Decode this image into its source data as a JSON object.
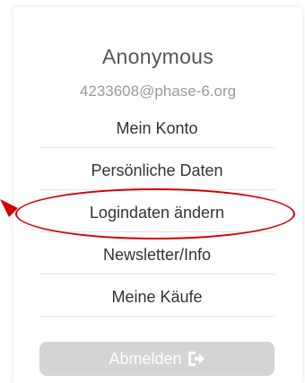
{
  "user": {
    "name": "Anonymous",
    "email": "4233608@phase-6.org"
  },
  "menu": {
    "items": [
      {
        "label": "Mein Konto"
      },
      {
        "label": "Persönliche Daten"
      },
      {
        "label": "Logindaten ändern"
      },
      {
        "label": "Newsletter/Info"
      },
      {
        "label": "Meine Käufe"
      }
    ]
  },
  "logout": {
    "label": "Abmelden",
    "icon": "logout-icon"
  },
  "colors": {
    "highlight": "#d40000",
    "button_disabled": "#d4d4d4",
    "text_primary": "#333333",
    "text_secondary": "#9a9a9a"
  }
}
